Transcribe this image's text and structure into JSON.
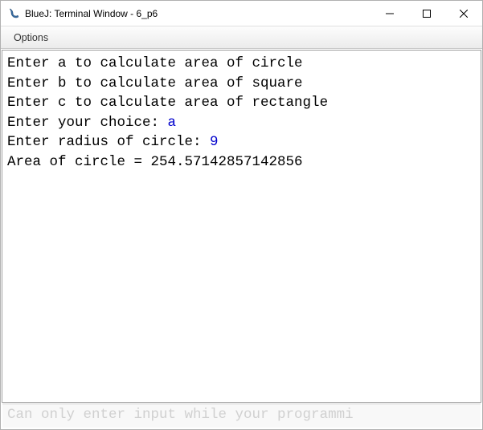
{
  "titlebar": {
    "title": "BlueJ: Terminal Window - 6_p6"
  },
  "menubar": {
    "options": "Options"
  },
  "terminal": {
    "lines": [
      {
        "prompt": "Enter a to calculate area of circle",
        "input": ""
      },
      {
        "prompt": "Enter b to calculate area of square",
        "input": ""
      },
      {
        "prompt": "Enter c to calculate area of rectangle",
        "input": ""
      },
      {
        "prompt": "Enter your choice: ",
        "input": "a"
      },
      {
        "prompt": "Enter radius of circle: ",
        "input": "9"
      },
      {
        "prompt": "Area of circle = 254.57142857142856",
        "input": ""
      }
    ]
  },
  "status": {
    "placeholder": "Can only enter input while your programmi"
  }
}
